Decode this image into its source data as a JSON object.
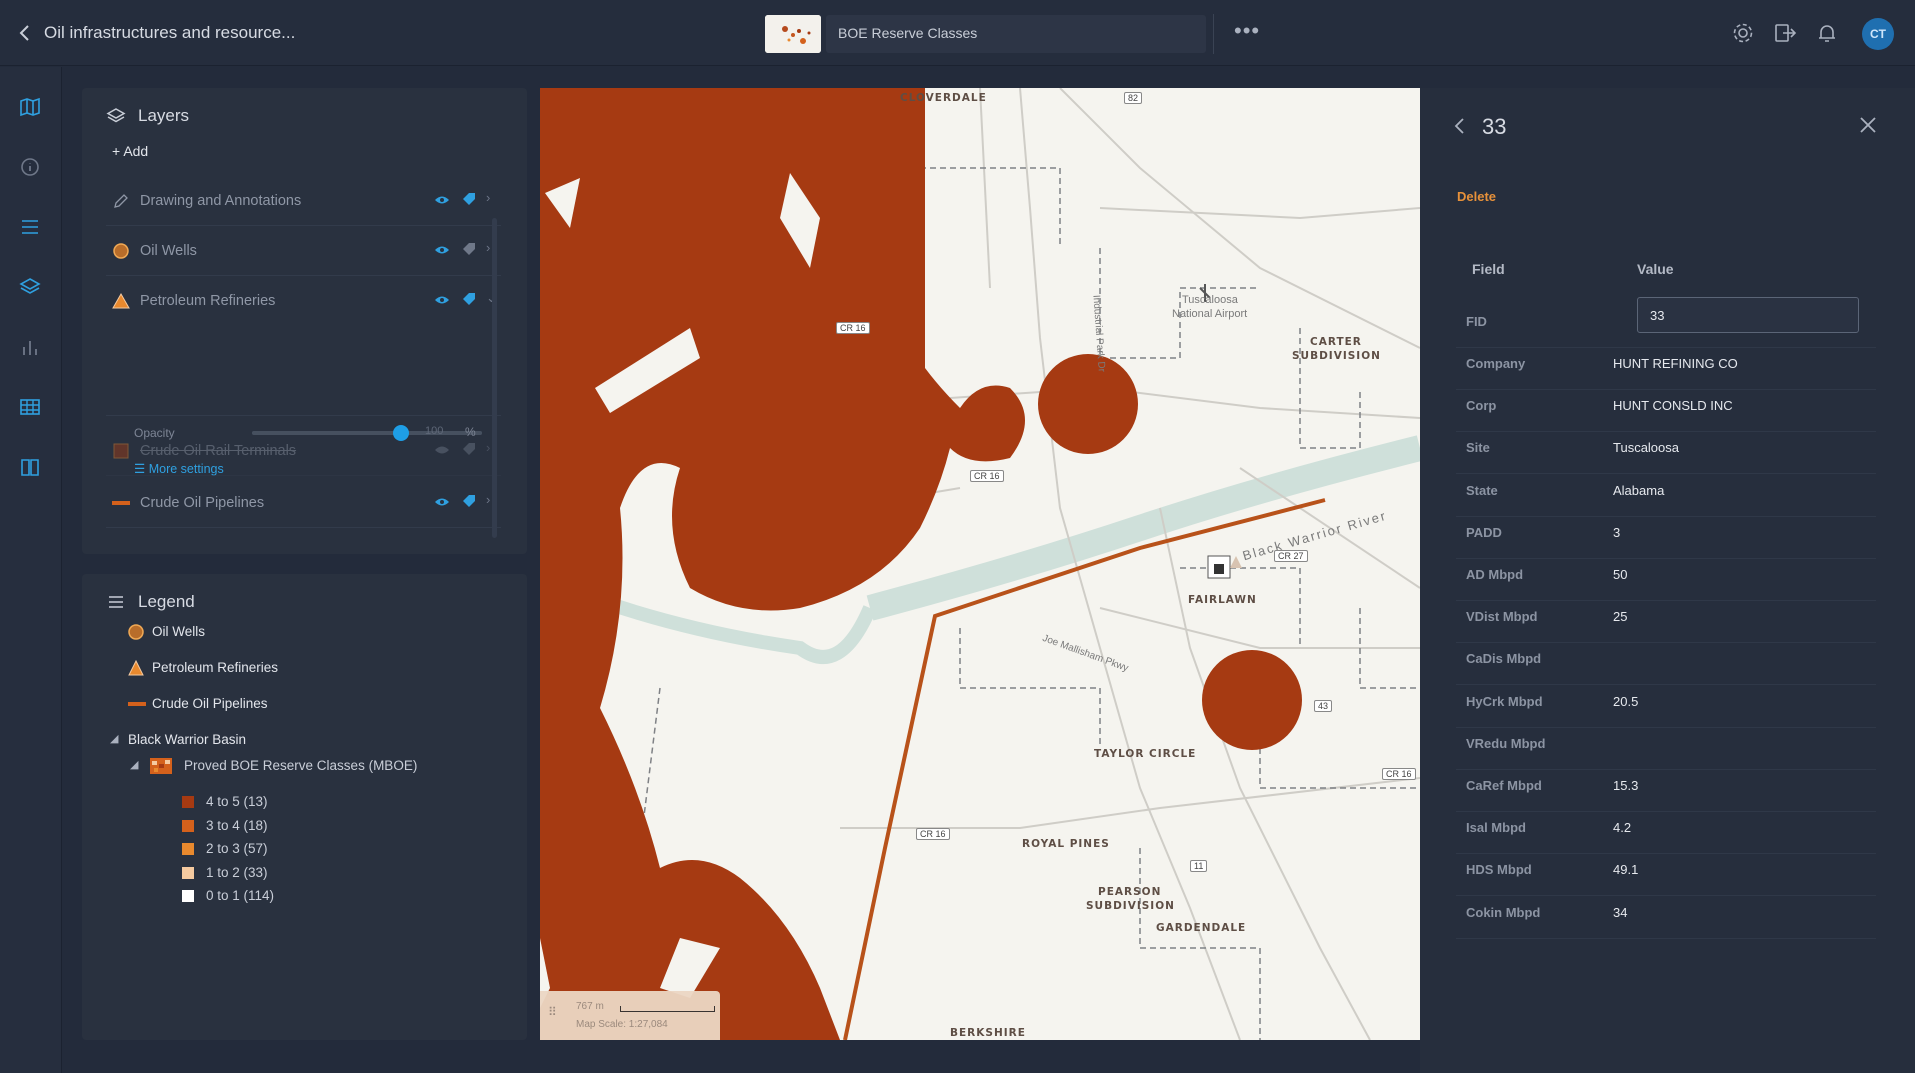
{
  "header": {
    "app_title": "Oil infrastructures and resource...",
    "map_name": "BOE Reserve Classes",
    "more": "•••",
    "avatar_initials": "CT"
  },
  "layers": {
    "title": "Layers",
    "add_label": "Add",
    "items": [
      {
        "label": "Drawing and Annotations",
        "icon": "pencil-icon"
      },
      {
        "label": "Oil Wells",
        "icon": "circle-icon"
      },
      {
        "label": "Petroleum Refineries",
        "icon": "triangle-icon"
      },
      {
        "label": "Crude Oil Rail Terminals",
        "icon": "square-icon"
      },
      {
        "label": "Crude Oil Pipelines",
        "icon": "line-icon"
      }
    ],
    "opacity_label": "Opacity",
    "opacity_value": "100",
    "opacity_unit": "%",
    "opacity_level": 1.0,
    "more_settings": "More settings"
  },
  "legend": {
    "title": "Legend",
    "items": [
      "Oil Wells",
      "Petroleum Refineries",
      "Crude Oil Pipelines"
    ],
    "group": "Black Warrior Basin",
    "subgroup": "Proved BOE Reserve Classes (MBOE)",
    "classes": [
      {
        "label": "4 to 5 (13)",
        "color": "#a63a12"
      },
      {
        "label": "3 to 4 (18)",
        "color": "#d4611c"
      },
      {
        "label": "2 to 3 (57)",
        "color": "#e8892e"
      },
      {
        "label": "1 to 2 (33)",
        "color": "#f5caa0"
      },
      {
        "label": "0 to 1 (114)",
        "color": "#ffffff"
      }
    ]
  },
  "map": {
    "scale_distance": "767 m",
    "scale_text": "Map Scale: 1:27,084",
    "labels": {
      "cloverdale": "CLOVERDALE",
      "airport": "Tuscaloosa",
      "airport2": "National Airport",
      "carter": "CARTER",
      "carter2": "SUBDIVISION",
      "fairlawn": "FAIRLAWN",
      "taylor": "TAYLOR CIRCLE",
      "royal": "ROYAL PINES",
      "pearson": "PEARSON",
      "pearson2": "SUBDIVISION",
      "gardendale": "GARDENDALE",
      "berkshire": "BERKSHIRE",
      "river": "Black Warrior River",
      "joe": "Joe Mallisham Pkwy",
      "industrial": "Industrial Park Dr"
    },
    "shields": {
      "cr16a": "CR 16",
      "cr16b": "CR 16",
      "cr16c": "CR 16",
      "cr16d": "CR 16",
      "cr27": "CR 27",
      "r82": "82",
      "r43": "43",
      "r11": "11"
    },
    "accent_color": "#a63a12"
  },
  "detail": {
    "title": "33",
    "delete_label": "Delete",
    "field_header": "Field",
    "value_header": "Value",
    "fid_name": "FID",
    "fid_value": "33",
    "rows": [
      {
        "field": "Company",
        "value": "HUNT REFINING CO"
      },
      {
        "field": "Corp",
        "value": "HUNT CONSLD INC"
      },
      {
        "field": "Site",
        "value": "Tuscaloosa"
      },
      {
        "field": "State",
        "value": "Alabama"
      },
      {
        "field": "PADD",
        "value": "3"
      },
      {
        "field": "AD Mbpd",
        "value": "50"
      },
      {
        "field": "VDist Mbpd",
        "value": "25"
      },
      {
        "field": "CaDis Mbpd",
        "value": ""
      },
      {
        "field": "HyCrk Mbpd",
        "value": "20.5"
      },
      {
        "field": "VRedu Mbpd",
        "value": ""
      },
      {
        "field": "CaRef Mbpd",
        "value": "15.3"
      },
      {
        "field": "Isal Mbpd",
        "value": "4.2"
      },
      {
        "field": "HDS Mbpd",
        "value": "49.1"
      },
      {
        "field": "Cokin Mbpd",
        "value": "34"
      }
    ]
  }
}
